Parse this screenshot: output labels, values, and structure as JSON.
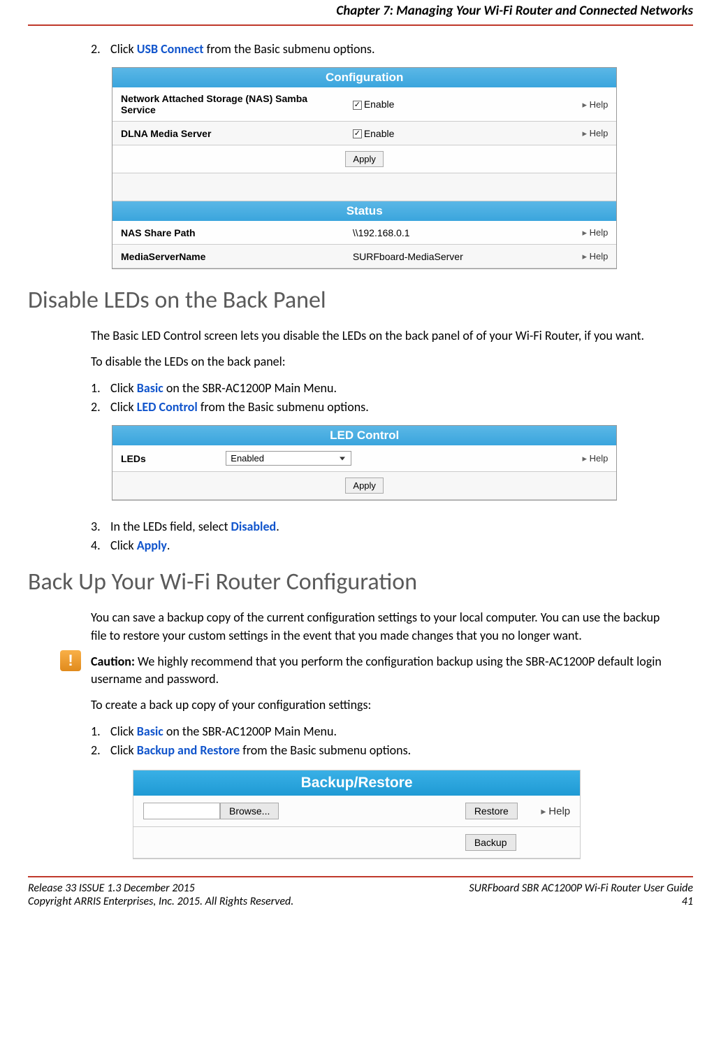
{
  "header": {
    "chapter": "Chapter 7: Managing Your Wi-Fi Router and Connected Networks"
  },
  "step2_top": {
    "pre": "Click ",
    "link": "USB Connect",
    "post": " from the Basic submenu options."
  },
  "screenshot1": {
    "section_config": "Configuration",
    "rows_config": [
      {
        "label": "Network Attached Storage (NAS) Samba Service",
        "enable": "Enable",
        "help": "Help"
      },
      {
        "label": "DLNA Media Server",
        "enable": "Enable",
        "help": "Help"
      }
    ],
    "apply": "Apply",
    "section_status": "Status",
    "rows_status": [
      {
        "label": "NAS Share Path",
        "value": "\\\\192.168.0.1",
        "help": "Help"
      },
      {
        "label": "MediaServerName",
        "value": "SURFboard-MediaServer",
        "help": "Help"
      }
    ]
  },
  "section_led": {
    "title": "Disable LEDs on the Back Panel"
  },
  "led_intro": "The Basic LED Control screen lets you disable the LEDs on the back panel of of your Wi-Fi Router, if you want.",
  "led_todo": "To disable the LEDs on the back panel:",
  "led_steps12": [
    {
      "pre": "Click ",
      "link": "Basic",
      "post": " on the SBR-AC1200P Main Menu."
    },
    {
      "pre": "Click ",
      "link": "LED Control",
      "post": " from the Basic submenu options."
    }
  ],
  "screenshot2": {
    "header": "LED Control",
    "row": {
      "label": "LEDs",
      "value": "Enabled",
      "help": "Help"
    },
    "apply": "Apply"
  },
  "led_steps34": [
    {
      "pre": "In the LEDs field, select ",
      "link": "Disabled",
      "post": "."
    },
    {
      "pre": "Click ",
      "link": "Apply",
      "post": "."
    }
  ],
  "section_backup": {
    "title": "Back Up Your Wi-Fi Router Configuration"
  },
  "backup_intro": "You can save a backup copy of the current configuration settings to your local computer. You can use the backup file to restore your custom settings in the event that you made changes that you no longer want.",
  "caution": {
    "glyph": "!",
    "label": "Caution:",
    "text": " We highly recommend that you perform the configuration backup using the SBR-AC1200P default login username and password."
  },
  "backup_todo": "To create a back up copy of your configuration settings:",
  "backup_steps": [
    {
      "pre": "Click ",
      "link": "Basic",
      "post": " on the SBR-AC1200P Main Menu."
    },
    {
      "pre": "Click ",
      "link": "Backup and Restore",
      "post": " from the Basic submenu options."
    }
  ],
  "screenshot3": {
    "header": "Backup/Restore",
    "browse": "Browse...",
    "restore": "Restore",
    "help": "Help",
    "backup": "Backup"
  },
  "footer": {
    "left1": "Release 33 ISSUE 1.3    December 2015",
    "left2": "Copyright ARRIS Enterprises, Inc. 2015. All Rights Reserved.",
    "right1": "SURFboard SBR AC1200P Wi-Fi Router User Guide",
    "right2": "41"
  }
}
